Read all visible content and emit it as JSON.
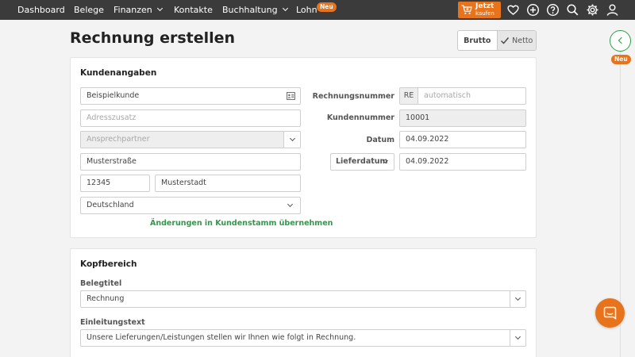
{
  "nav": {
    "items": [
      {
        "label": "Dashboard"
      },
      {
        "label": "Belege"
      },
      {
        "label": "Finanzen"
      },
      {
        "label": "Kontakte"
      },
      {
        "label": "Buchhaltung"
      },
      {
        "label": "Lohn"
      }
    ],
    "lohn_badge": "Neu",
    "buy_line1": "Jetzt",
    "buy_line2": "kaufen",
    "icons": [
      "cart-icon",
      "heart-icon",
      "plus-circle-icon",
      "help-icon",
      "search-icon",
      "gear-icon",
      "user-icon"
    ]
  },
  "page": {
    "title": "Rechnung erstellen",
    "toggle": {
      "brutto": "Brutto",
      "netto": "Netto",
      "selected": "Netto"
    }
  },
  "kunden": {
    "title": "Kundenangaben",
    "customer": "Beispielkunde",
    "address_extra_placeholder": "Adresszusatz",
    "contact_placeholder": "Ansprechpartner",
    "street": "Musterstraße",
    "zip": "12345",
    "city": "Musterstadt",
    "country": "Deutschland",
    "apply_link": "Änderungen in Kundenstamm übernehmen",
    "rechnungsnummer_label": "Rechnungsnummer",
    "rechnungsnummer_prefix": "RE",
    "rechnungsnummer_placeholder": "automatisch",
    "kundennummer_label": "Kundennummer",
    "kundennummer": "10001",
    "datum_label": "Datum",
    "datum": "04.09.2022",
    "lieferdatum_select": "Lieferdatum",
    "lieferdatum": "04.09.2022"
  },
  "kopf": {
    "title": "Kopfbereich",
    "belegtitel_label": "Belegtitel",
    "belegtitel": "Rechnung",
    "einleitung_label": "Einleitungstext",
    "einleitung": "Unsere Lieferungen/Leistungen stellen wir Ihnen wie folgt in Rechnung."
  },
  "rail": {
    "badge": "Neu"
  },
  "colors": {
    "accent": "#e8731d",
    "green": "#2e9b48",
    "topbar": "#3b3b3b"
  }
}
